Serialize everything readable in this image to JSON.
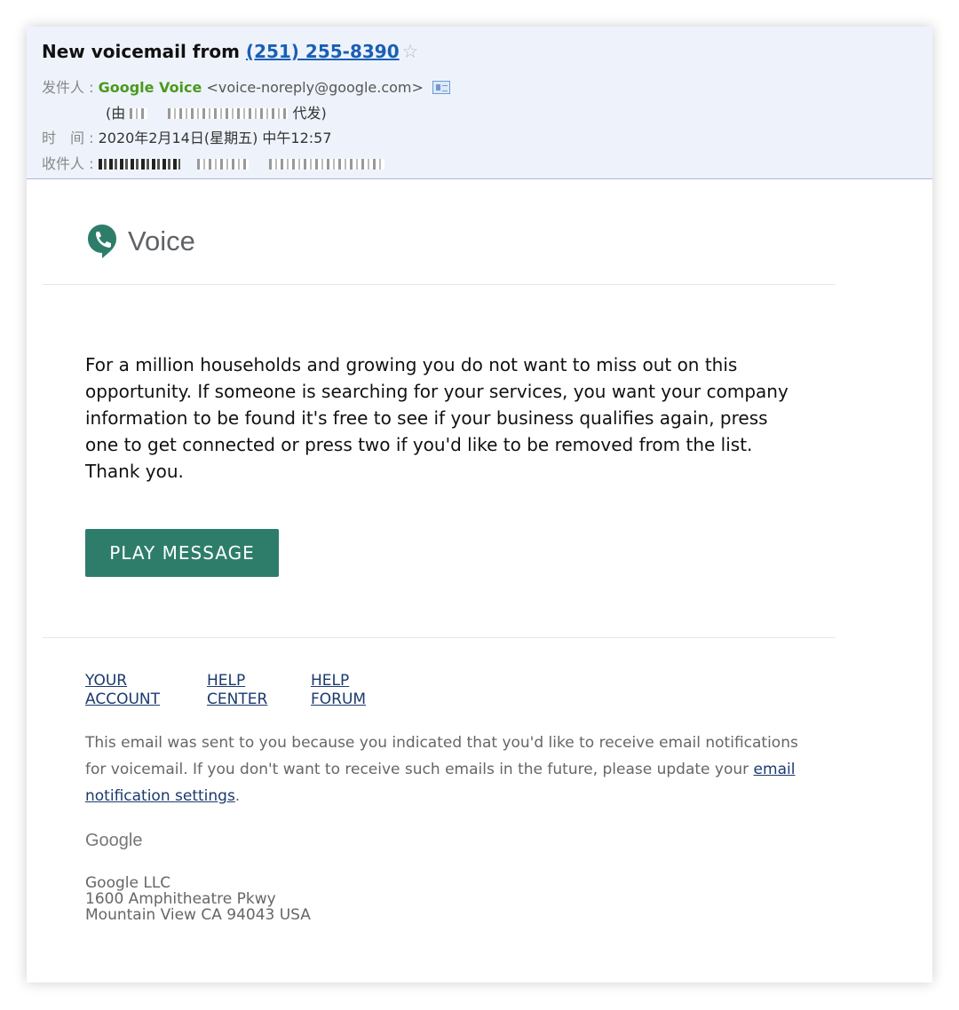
{
  "header": {
    "subject_prefix": "New voicemail from",
    "subject_phone": "(251) 255-8390",
    "from_label": "发件人 :",
    "from_name": "Google Voice",
    "from_email": "<voice-noreply@google.com>",
    "via_prefix": "(由",
    "via_suffix": "代发)",
    "time_label": "时　间 :",
    "time_value": "2020年2月14日(星期五) 中午12:57",
    "to_label": "收件人 :"
  },
  "brand": {
    "name": "Voice",
    "color": "#2e7d6b"
  },
  "message": {
    "text": "For a million households and growing you do not want to miss out on this opportunity. If someone is searching for your services, you want your company information to be found it's free to see if your business qualifies again, press one to get connected or press two if you'd like to be removed from the list. Thank you.",
    "play_button": "PLAY MESSAGE"
  },
  "footer": {
    "links": [
      {
        "line1": "YOUR",
        "line2": "ACCOUNT"
      },
      {
        "line1": "HELP",
        "line2": "CENTER"
      },
      {
        "line1": "HELP",
        "line2": "FORUM"
      }
    ],
    "notice_text": "This email was sent to you because you indicated that you'd like to receive email notifications for voicemail. If you don't want to receive such emails in the future, please update your",
    "notice_link": "email notification settings",
    "notice_end": ".",
    "google_logo": "Google",
    "address_line1": "Google LLC",
    "address_line2": "1600 Amphitheatre Pkwy",
    "address_line3": "Mountain View CA 94043 USA"
  }
}
